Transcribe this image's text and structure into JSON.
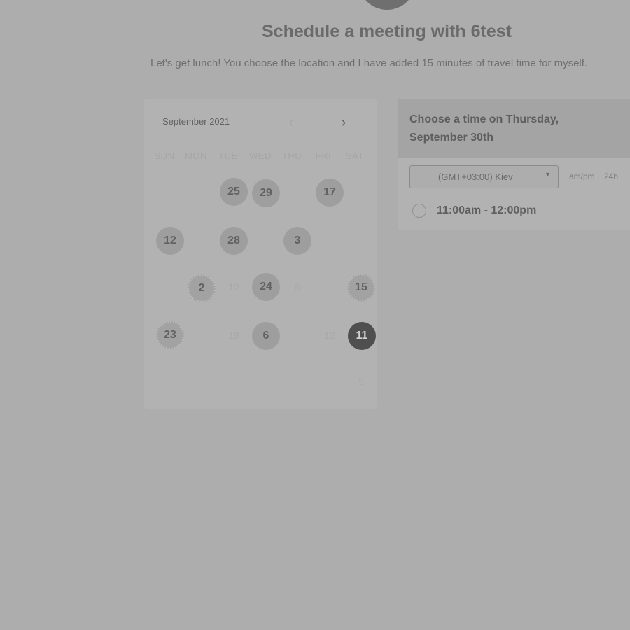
{
  "header": {
    "title": "Schedule a meeting with 6test",
    "subtitle": "Let's get lunch! You choose the location and I have added 15 minutes of travel time for myself."
  },
  "calendar": {
    "month_label": "September 2021",
    "prev_icon": "‹",
    "next_icon": "›",
    "weekdays": [
      "SUN",
      "MON",
      "TUE",
      "WED",
      "THU",
      "FRI",
      "SAT"
    ],
    "days": [
      {
        "label": "25",
        "state": "available"
      },
      {
        "label": "29",
        "state": "available"
      },
      {
        "label": "17",
        "state": "available"
      },
      {
        "label": "12",
        "state": "available"
      },
      {
        "label": "28",
        "state": "available"
      },
      {
        "label": "3",
        "state": "available"
      },
      {
        "label": "2",
        "state": "highlighted"
      },
      {
        "label": "12",
        "state": "unavailable"
      },
      {
        "label": "24",
        "state": "available"
      },
      {
        "label": "5",
        "state": "unavailable"
      },
      {
        "label": "15",
        "state": "highlighted"
      },
      {
        "label": "23",
        "state": "highlighted"
      },
      {
        "label": "19",
        "state": "unavailable"
      },
      {
        "label": "6",
        "state": "available"
      },
      {
        "label": "12",
        "state": "unavailable"
      },
      {
        "label": "11",
        "state": "selected"
      },
      {
        "label": "5",
        "state": "unavailable"
      }
    ]
  },
  "time_panel": {
    "heading": "Choose a time on Thursday, September 30th",
    "timezone": {
      "value": "(GMT+03:00) Kiev",
      "caret_icon": "▼"
    },
    "format_ampm": "am/pm",
    "format_24h": "24h",
    "slots": [
      {
        "label": "11:00am - 12:00pm"
      }
    ]
  }
}
